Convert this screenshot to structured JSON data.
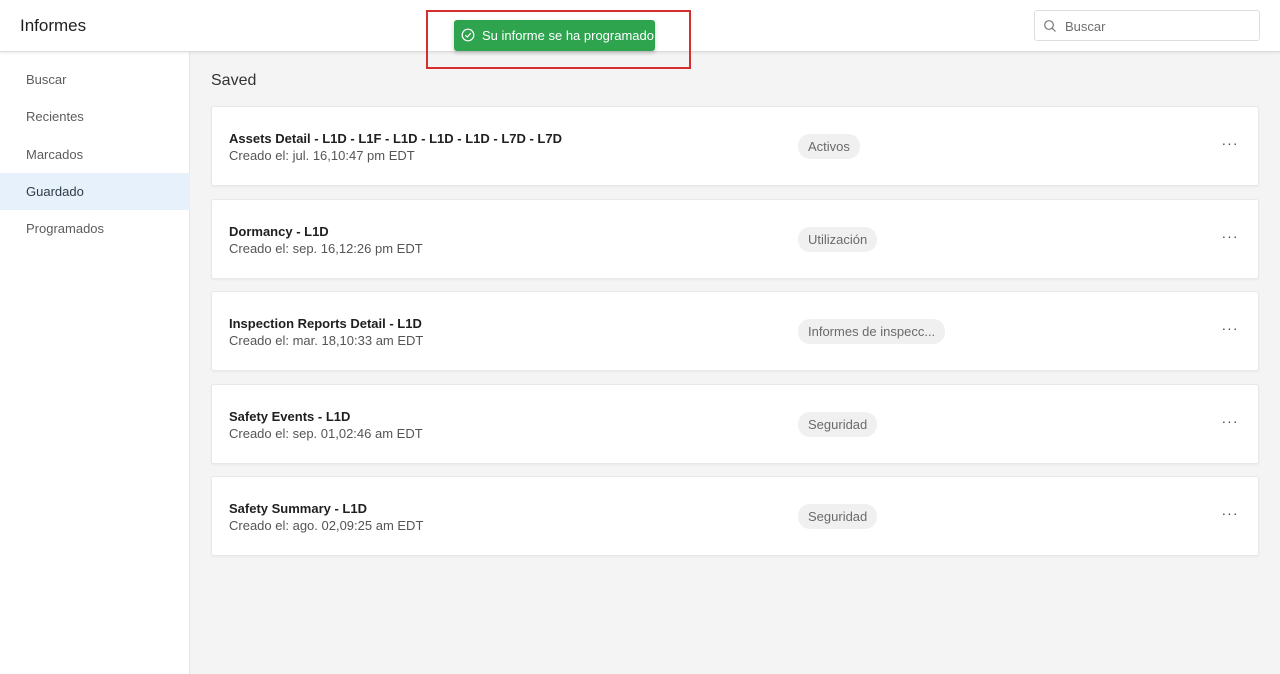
{
  "header": {
    "title": "Informes",
    "search": {
      "placeholder": "Buscar",
      "value": ""
    }
  },
  "toast": {
    "message": "Su informe se ha programado.",
    "color": "#2ea44f",
    "icon": "check-circle-icon"
  },
  "sidebar": {
    "items": [
      {
        "label": "Buscar",
        "active": false
      },
      {
        "label": "Recientes",
        "active": false
      },
      {
        "label": "Marcados",
        "active": false
      },
      {
        "label": "Guardado",
        "active": true
      },
      {
        "label": "Programados",
        "active": false
      }
    ]
  },
  "main": {
    "section_title": "Saved",
    "reports": [
      {
        "name": "Assets Detail - L1D - L1F - L1D - L1D - L1D - L7D - L7D",
        "created": "Creado el: jul. 16,10:47 pm EDT",
        "category": "Activos",
        "menu": "···"
      },
      {
        "name": "Dormancy - L1D",
        "created": "Creado el: sep. 16,12:26 pm EDT",
        "category": "Utilización",
        "menu": "···"
      },
      {
        "name": "Inspection Reports Detail - L1D",
        "created": "Creado el: mar. 18,10:33 am EDT",
        "category": "Informes de inspecc...",
        "menu": "···"
      },
      {
        "name": "Safety Events - L1D",
        "created": "Creado el: sep. 01,02:46 am EDT",
        "category": "Seguridad",
        "menu": "···"
      },
      {
        "name": "Safety Summary - L1D",
        "created": "Creado el: ago. 02,09:25 am EDT",
        "category": "Seguridad",
        "menu": "···"
      }
    ]
  }
}
